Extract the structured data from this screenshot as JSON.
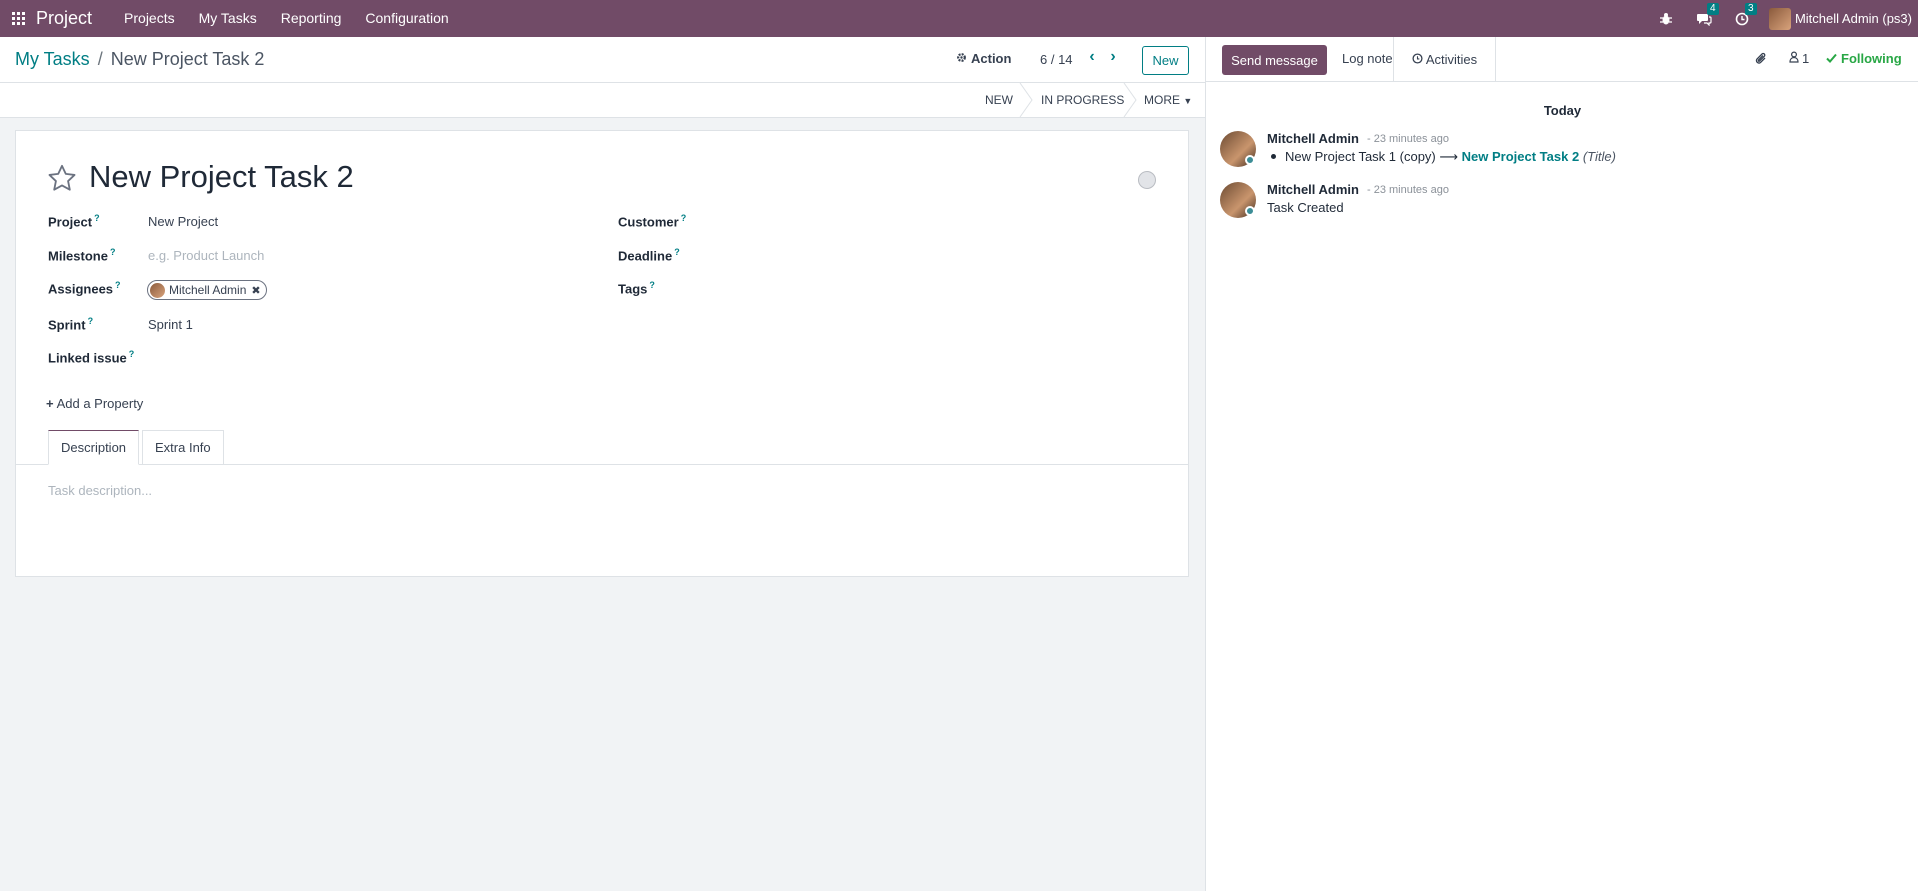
{
  "navbar": {
    "brand": "Project",
    "menu": [
      "Projects",
      "My Tasks",
      "Reporting",
      "Configuration"
    ],
    "messages_count": "4",
    "activities_count": "3",
    "user": "Mitchell Admin (ps3)"
  },
  "control": {
    "breadcrumb_parent": "My Tasks",
    "breadcrumb_sep": "/",
    "breadcrumb_current": "New Project Task 2",
    "action_label": "Action",
    "pager": "6 / 14",
    "new_label": "New"
  },
  "stages": {
    "items": [
      "NEW",
      "IN PROGRESS"
    ],
    "more": "MORE"
  },
  "task": {
    "title": "New Project Task 2",
    "fields": {
      "project_label": "Project",
      "project_value": "New Project",
      "milestone_label": "Milestone",
      "milestone_placeholder": "e.g. Product Launch",
      "assignees_label": "Assignees",
      "assignee": "Mitchell Admin",
      "sprint_label": "Sprint",
      "sprint_value": "Sprint 1",
      "linked_issue_label": "Linked issue",
      "customer_label": "Customer",
      "deadline_label": "Deadline",
      "tags_label": "Tags",
      "help_mark": "?"
    },
    "add_property": "Add a Property",
    "tabs": [
      "Description",
      "Extra Info"
    ],
    "description_placeholder": "Task description..."
  },
  "chatter": {
    "send_message": "Send message",
    "log_note": "Log note",
    "activities": "Activities",
    "followers_count": "1",
    "following": "Following",
    "day": "Today",
    "messages": [
      {
        "author": "Mitchell Admin",
        "time": "- 23 minutes ago",
        "old_value": "New Project Task 1 (copy)",
        "arrow": "⟶",
        "new_value": "New Project Task 2",
        "field": "(Title)"
      },
      {
        "author": "Mitchell Admin",
        "time": "- 23 minutes ago",
        "body": "Task Created"
      }
    ]
  },
  "colors": {
    "brand": "#714b67",
    "accent": "#017e84",
    "following": "#28a745"
  }
}
